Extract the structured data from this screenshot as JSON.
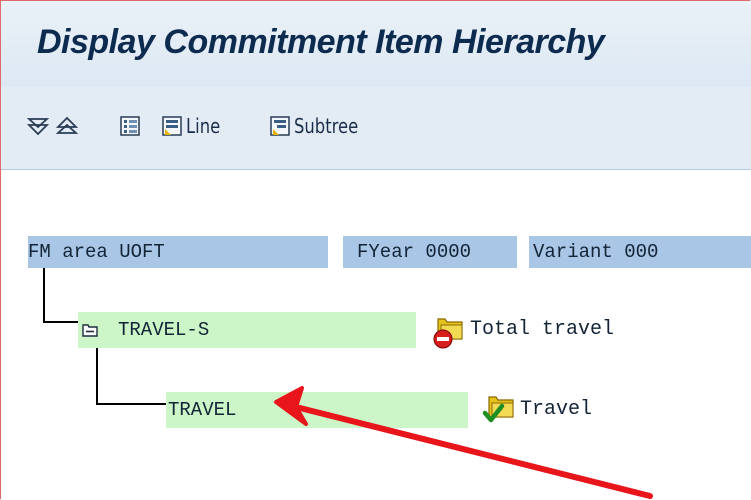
{
  "header": {
    "title": "Display Commitment Item Hierarchy"
  },
  "toolbar": {
    "expand_icon": "expand-all-icon",
    "collapse_icon": "collapse-all-icon",
    "hierarchy_icon": "hierarchy-list-icon",
    "line_label": "Line",
    "subtree_label": "Subtree"
  },
  "tree": {
    "header": {
      "fm_area": "FM area UOFT",
      "fyear": "FYear 0000",
      "variant": "Variant 000"
    },
    "nodes": [
      {
        "code": "TRAVEL-S",
        "description": "Total travel",
        "status_icon": "blocked-folder-icon",
        "expanded": true
      },
      {
        "code": "TRAVEL",
        "description": "Travel",
        "status_icon": "checked-folder-icon"
      }
    ]
  },
  "colors": {
    "title": "#0d2a4f",
    "header_cell": "#a9c6e6",
    "node_bar": "#ccf5c8",
    "annotation_arrow": "#e8151b"
  }
}
